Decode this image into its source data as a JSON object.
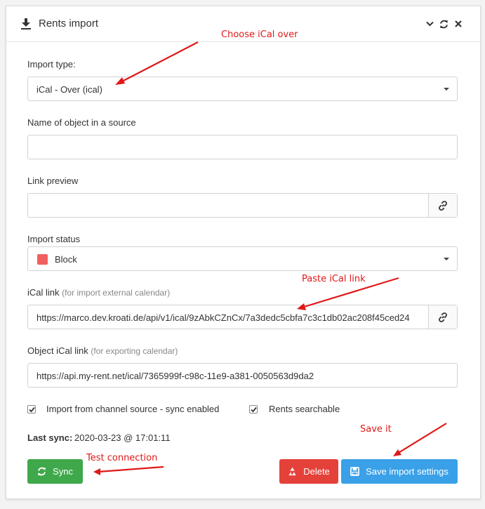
{
  "header": {
    "title": "Rents import"
  },
  "form": {
    "import_type": {
      "label": "Import type:",
      "value": "iCal - Over (ical)"
    },
    "object_name": {
      "label": "Name of object in a source",
      "value": ""
    },
    "link_preview": {
      "label": "Link preview",
      "value": ""
    },
    "import_status": {
      "label": "Import status",
      "value": "Block",
      "swatch_color": "#f06060"
    },
    "ical_link": {
      "label": "iCal link",
      "hint": "(for import external calendar)",
      "value": "https://marco.dev.kroati.de/api/v1/ical/9zAbkCZnCx/7a3dedc5cbfa7c3c1db02ac208f45ced24"
    },
    "object_ical_link": {
      "label": "Object iCal link",
      "hint": "(for exporting calendar)",
      "value": "https://api.my-rent.net/ical/7365999f-c98c-11e9-a381-0050563d9da2"
    },
    "checkboxes": [
      {
        "label": "Import from channel source - sync enabled",
        "checked": true
      },
      {
        "label": "Rents searchable",
        "checked": true
      }
    ],
    "last_sync": {
      "label": "Last sync:",
      "value": "2020-03-23 @ 17:01:11"
    }
  },
  "buttons": {
    "sync": "Sync",
    "delete": "Delete",
    "save": "Save import settings"
  },
  "annotations": {
    "choose": "Choose iCal over",
    "paste": "Paste iCal link",
    "save_it": "Save it",
    "test": "Test connection"
  },
  "colors": {
    "sync_green": "#3fa84b",
    "delete_red": "#e5413b",
    "save_blue": "#3aa0e8",
    "annotation_red": "#e01818"
  },
  "icons": [
    "download-icon",
    "chevron-down-icon",
    "refresh-icon",
    "close-icon",
    "link-icon",
    "check-icon",
    "sync-icon",
    "recycle-icon",
    "floppy-icon"
  ]
}
